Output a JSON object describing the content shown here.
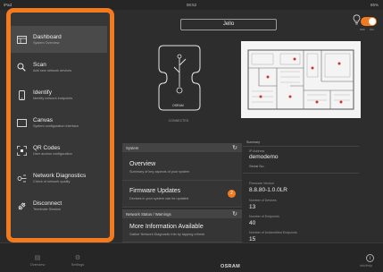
{
  "status_bar": {
    "carrier": "iPad",
    "time": "08:52",
    "battery": "85%"
  },
  "header": {
    "device_name": "Jello",
    "toggle_off": "OFF",
    "toggle_on": "ON"
  },
  "sidebar": {
    "items": [
      {
        "title": "Dashboard",
        "subtitle": "System Overview",
        "icon": "dashboard-icon"
      },
      {
        "title": "Scan",
        "subtitle": "Add new network devices",
        "icon": "search-icon"
      },
      {
        "title": "Identify",
        "subtitle": "Identify network endpoints",
        "icon": "mobile-device-icon"
      },
      {
        "title": "Canvas",
        "subtitle": "System configuration interface",
        "icon": "canvas-icon"
      },
      {
        "title": "QR Codes",
        "subtitle": "User access configuration",
        "icon": "qr-code-icon"
      },
      {
        "title": "Network Diagnostics",
        "subtitle": "Check of network quality",
        "icon": "network-diagnostics-icon"
      },
      {
        "title": "Disconnect",
        "subtitle": "Terminate Session",
        "icon": "disconnect-icon"
      }
    ]
  },
  "device": {
    "brand": "OSRAM",
    "caption": "CONNECTED"
  },
  "system_section": {
    "header": "System",
    "overview_title": "Overview",
    "overview_sub": "Summary of key aspects of your system",
    "firmware_title": "Firmware Updates",
    "firmware_sub": "Devices in your system can be updated",
    "firmware_badge": "2"
  },
  "network_section": {
    "header": "Network Status / Warnings",
    "info_title": "More Information Available",
    "info_sub": "Gather Network Diagnostic Info by tapping refresh"
  },
  "summary": {
    "title": "Summary",
    "ip_label": "IP Address",
    "ip_value": "demodemo",
    "serial_label": "Serial No.",
    "firmware_label": "Firmware Version",
    "firmware_value": "8.8.80-1.0.0LR",
    "devices_label": "Number of Devices",
    "devices_value": "13",
    "endpoints_label": "Number of Endpoints",
    "endpoints_value": "40",
    "unidentified_label": "Number of Unidentified Endpoints",
    "unidentified_value": "15"
  },
  "tabbar": {
    "tab1": "Overview",
    "tab2": "Settings",
    "brand": "OSRAM",
    "info": "i",
    "info_label": "Info/Help"
  },
  "colors": {
    "accent": "#f47a20",
    "background": "#2d2d2d",
    "sidebar": "#373737"
  }
}
